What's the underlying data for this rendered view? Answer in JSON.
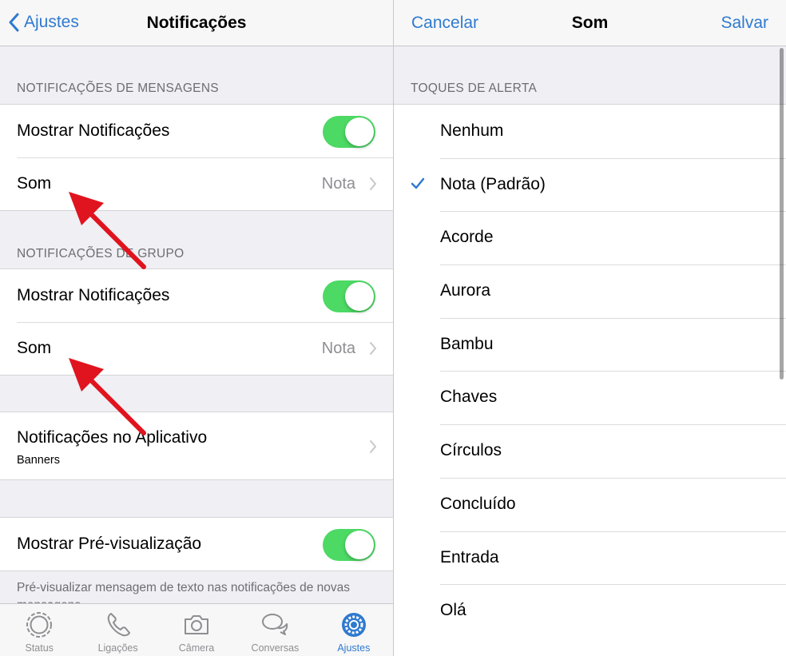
{
  "left": {
    "nav": {
      "back_label": "Ajustes",
      "title": "Notificações"
    },
    "messages_section": {
      "header": "NOTIFICAÇÕES DE MENSAGENS",
      "show_label": "Mostrar Notificações",
      "sound_label": "Som",
      "sound_value": "Nota"
    },
    "group_section": {
      "header": "NOTIFICAÇÕES DE GRUPO",
      "show_label": "Mostrar Notificações",
      "sound_label": "Som",
      "sound_value": "Nota"
    },
    "in_app": {
      "label": "Notificações no Aplicativo",
      "sub": "Banners"
    },
    "preview": {
      "label": "Mostrar Pré-visualização",
      "note": "Pré-visualizar mensagem de texto nas notificações de novas mensagens."
    },
    "tabs": [
      {
        "label": "Status",
        "icon": "status-icon"
      },
      {
        "label": "Ligações",
        "icon": "phone-icon"
      },
      {
        "label": "Câmera",
        "icon": "camera-icon"
      },
      {
        "label": "Conversas",
        "icon": "chats-icon"
      },
      {
        "label": "Ajustes",
        "icon": "gear-icon"
      }
    ]
  },
  "right": {
    "nav": {
      "cancel_label": "Cancelar",
      "title": "Som",
      "save_label": "Salvar"
    },
    "section_header": "TOQUES DE ALERTA",
    "tones": [
      "Nenhum",
      "Nota (Padrão)",
      "Acorde",
      "Aurora",
      "Bambu",
      "Chaves",
      "Círculos",
      "Concluído",
      "Entrada",
      "Olá"
    ],
    "selected_index": 1
  },
  "colors": {
    "accent": "#2f7ad0",
    "toggle_on": "#4cd964",
    "annotation_arrow": "#e0141e"
  }
}
